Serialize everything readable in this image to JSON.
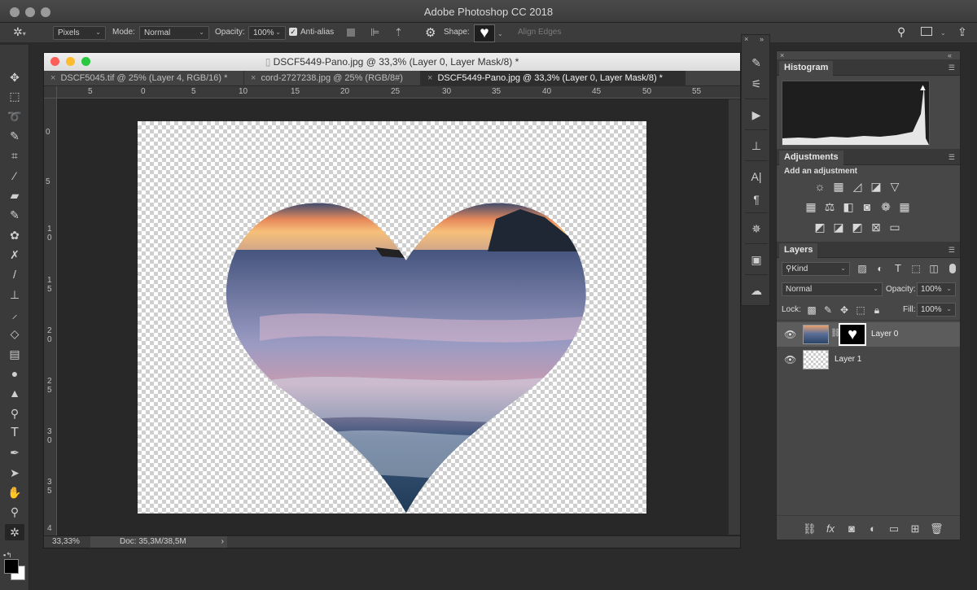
{
  "app": {
    "title": "Adobe Photoshop CC 2018"
  },
  "options": {
    "mode_select": "Pixels",
    "mode_label": "Mode:",
    "blend_mode": "Normal",
    "opacity_label": "Opacity:",
    "opacity_value": "100%",
    "antialias_label": "Anti-alias",
    "shape_label": "Shape:",
    "align_edges_label": "Align Edges"
  },
  "document": {
    "window_title": "DSCF5449-Pano.jpg @ 33,3% (Layer 0, Layer Mask/8) *",
    "tabs": [
      {
        "label": "DSCF5045.tif @ 25% (Layer 4, RGB/16) *"
      },
      {
        "label": "cord-2727238.jpg @ 25% (RGB/8#)"
      },
      {
        "label": "DSCF5449-Pano.jpg @ 33,3% (Layer 0, Layer Mask/8) *"
      }
    ],
    "ruler_top": [
      "5",
      "0",
      "5",
      "10",
      "15",
      "20",
      "25",
      "30",
      "35",
      "40",
      "45",
      "50",
      "55"
    ],
    "ruler_left": [
      "0",
      "5",
      "1 0",
      "1 5",
      "2 0",
      "2 5",
      "3 0",
      "3 5",
      "4"
    ],
    "zoom": "33,33%",
    "doc_size": "Doc: 35,3M/38,5M"
  },
  "panels": {
    "histogram": {
      "title": "Histogram"
    },
    "adjustments": {
      "title": "Adjustments",
      "subtitle": "Add an adjustment"
    },
    "layers": {
      "title": "Layers",
      "filter_label": "Kind",
      "blend_mode": "Normal",
      "opacity_label": "Opacity:",
      "opacity_value": "100%",
      "lock_label": "Lock:",
      "fill_label": "Fill:",
      "fill_value": "100%",
      "items": [
        {
          "name": "Layer 0",
          "selected": true
        },
        {
          "name": "Layer 1",
          "selected": false
        }
      ]
    }
  },
  "colors": {
    "accent_selected_layer": "#5c5c5c",
    "pasteboard": "#282828",
    "panel_bg": "#474747"
  }
}
